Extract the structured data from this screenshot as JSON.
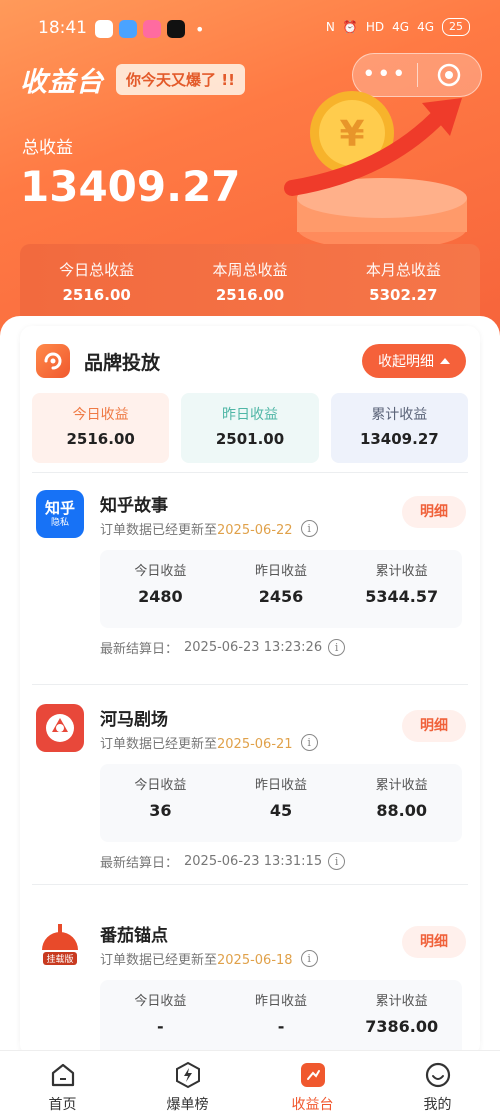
{
  "status_bar": {
    "time": "18:41",
    "battery": "25",
    "signal_a": "4G",
    "signal_b": "4G",
    "hd": "HD"
  },
  "header": {
    "title": "收益台",
    "tagline": "你今天又爆了 !!"
  },
  "capsule": {
    "more": "•••"
  },
  "summary": {
    "total_label": "总收益",
    "total_value": "13409.27"
  },
  "periods": [
    {
      "label": "今日总收益",
      "value": "2516.00"
    },
    {
      "label": "本周总收益",
      "value": "2516.00"
    },
    {
      "label": "本月总收益",
      "value": "5302.27"
    }
  ],
  "brand_card": {
    "title": "品牌投放",
    "collapse_label": "收起明细",
    "totals": [
      {
        "label": "今日收益",
        "value": "2516.00"
      },
      {
        "label": "昨日收益",
        "value": "2501.00"
      },
      {
        "label": "累计收益",
        "value": "13409.27"
      }
    ]
  },
  "items": [
    {
      "name": "知乎故事",
      "update_prefix": "订单数据已经更新至",
      "update_date": "2025-06-22",
      "detail_label": "明细",
      "logo_text": "知乎",
      "logo_sub": "隐私",
      "stats": [
        {
          "label": "今日收益",
          "value": "2480"
        },
        {
          "label": "昨日收益",
          "value": "2456"
        },
        {
          "label": "累计收益",
          "value": "5344.57"
        }
      ],
      "settle_label": "最新结算日：",
      "settle_time": "2025-06-23 13:23:26"
    },
    {
      "name": "河马剧场",
      "update_prefix": "订单数据已经更新至",
      "update_date": "2025-06-21",
      "detail_label": "明细",
      "stats": [
        {
          "label": "今日收益",
          "value": "36"
        },
        {
          "label": "昨日收益",
          "value": "45"
        },
        {
          "label": "累计收益",
          "value": "88.00"
        }
      ],
      "settle_label": "最新结算日：",
      "settle_time": "2025-06-23 13:31:15"
    },
    {
      "name": "番茄锚点",
      "update_prefix": "订单数据已经更新至",
      "update_date": "2025-06-18",
      "detail_label": "明细",
      "logo_text": "挂载版",
      "stats": [
        {
          "label": "今日收益",
          "value": "-"
        },
        {
          "label": "昨日收益",
          "value": "-"
        },
        {
          "label": "累计收益",
          "value": "7386.00"
        }
      ]
    }
  ],
  "tabs": [
    {
      "label": "首页",
      "icon": "home-icon"
    },
    {
      "label": "爆单榜",
      "icon": "lightning-icon"
    },
    {
      "label": "收益台",
      "icon": "earnings-icon",
      "active": true
    },
    {
      "label": "我的",
      "icon": "profile-icon"
    }
  ],
  "colors": {
    "accent": "#f5613a",
    "date": "#e0a14a",
    "hero_start": "#ff9a5a"
  }
}
